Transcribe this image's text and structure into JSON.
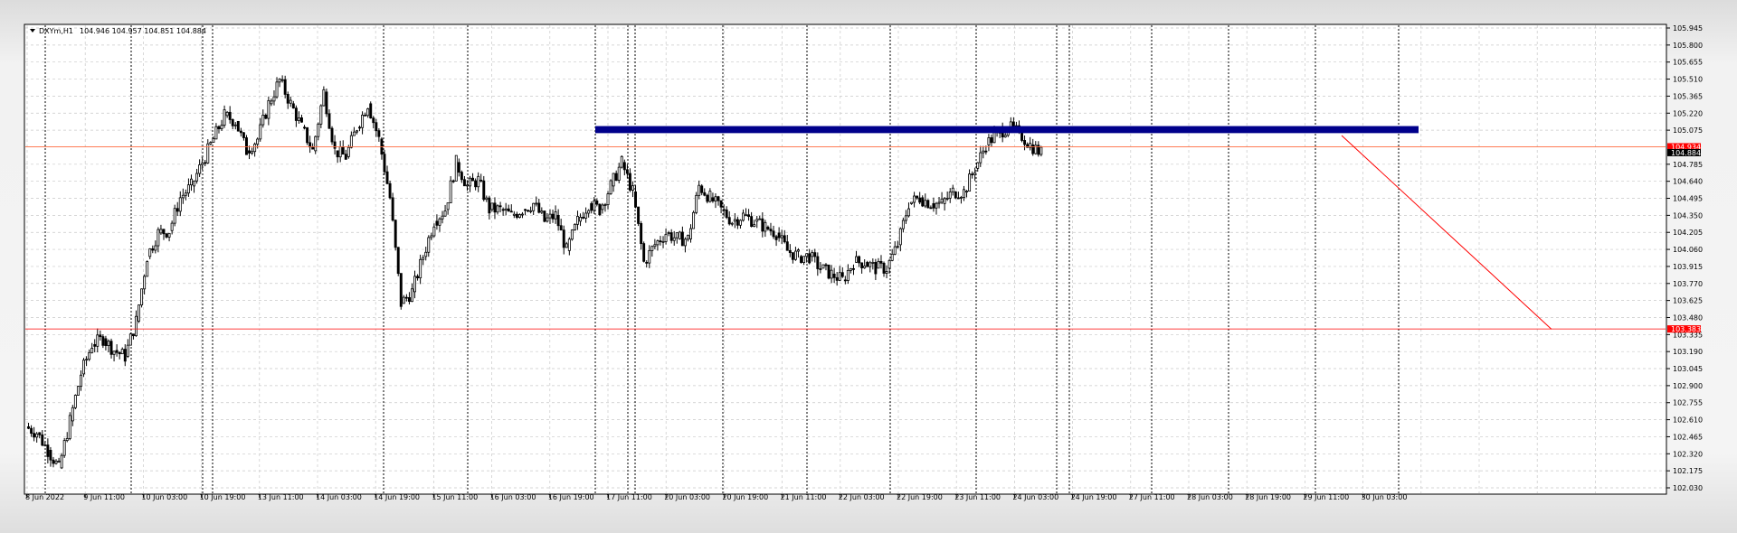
{
  "window": {
    "symbol_label": "DXYm,H1",
    "ohlc_label": "104.946 104.957 104.851 104.884"
  },
  "colors": {
    "background": "#ffffff",
    "grid": "#c8c8c8",
    "candle": "#000000",
    "resistance_zone": "#00008b",
    "support_line": "#ff0000",
    "trend_line": "#ff0000",
    "current_price_tag": "#000000",
    "line_price_tag": "#ff0000"
  },
  "price_scale_labels": [
    "105.945",
    "105.800",
    "105.655",
    "105.510",
    "105.365",
    "105.220",
    "105.075",
    "104.785",
    "104.640",
    "104.495",
    "104.350",
    "104.205",
    "104.060",
    "103.915",
    "103.770",
    "103.625",
    "103.480",
    "103.335",
    "103.190",
    "103.045",
    "102.900",
    "102.755",
    "102.610",
    "102.465",
    "102.320",
    "102.175",
    "102.030"
  ],
  "price_tags": {
    "line_price": "104.934",
    "current_price": "104.884",
    "support_price": "103.383"
  },
  "time_labels": [
    "8 Jun 2022",
    "9 Jun 11:00",
    "10 Jun 03:00",
    "10 Jun 19:00",
    "13 Jun 11:00",
    "14 Jun 03:00",
    "14 Jun 19:00",
    "15 Jun 11:00",
    "16 Jun 03:00",
    "16 Jun 19:00",
    "17 Jun 11:00",
    "20 Jun 03:00",
    "20 Jun 19:00",
    "21 Jun 11:00",
    "22 Jun 03:00",
    "22 Jun 19:00",
    "23 Jun 11:00",
    "24 Jun 03:00",
    "24 Jun 19:00",
    "27 Jun 11:00",
    "28 Jun 03:00",
    "28 Jun 19:00",
    "29 Jun 11:00",
    "30 Jun 03:00"
  ],
  "chart_data": {
    "type": "candlestick",
    "symbol": "DXYm",
    "timeframe": "H1",
    "y_range": [
      102.03,
      105.945
    ],
    "x_range": [
      "8 Jun 2022",
      "30 Jun 03:00"
    ],
    "grid": true,
    "ohlc_last": {
      "open": 104.946,
      "high": 104.957,
      "low": 104.851,
      "close": 104.884
    },
    "horizontal_levels": [
      {
        "kind": "resistance_zone",
        "price_low": 105.05,
        "price_high": 105.11,
        "from": "17 Jun 08:00",
        "to": "1 Jul 00:00"
      },
      {
        "kind": "line",
        "price": 104.934
      },
      {
        "kind": "support_line",
        "price": 103.383
      }
    ],
    "trend_line": {
      "from": {
        "time": "30 Jun 03:00",
        "price": 105.03
      },
      "to": {
        "time": "4 Jul",
        "price": 103.38
      }
    },
    "price_path": [
      {
        "time": "8 Jun 2022",
        "price": 102.55
      },
      {
        "time": "8 Jun 22:00",
        "price": 102.5
      },
      {
        "time": "9 Jun 04:00",
        "price": 102.35
      },
      {
        "time": "9 Jun 07:00",
        "price": 102.2
      },
      {
        "time": "9 Jun 11:00",
        "price": 102.6
      },
      {
        "time": "9 Jun 15:00",
        "price": 103.0
      },
      {
        "time": "9 Jun 19:00",
        "price": 103.25
      },
      {
        "time": "9 Jun 23:00",
        "price": 103.3
      },
      {
        "time": "10 Jun 03:00",
        "price": 103.2
      },
      {
        "time": "10 Jun 07:00",
        "price": 103.15
      },
      {
        "time": "10 Jun 11:00",
        "price": 103.45
      },
      {
        "time": "10 Jun 15:00",
        "price": 104.0
      },
      {
        "time": "10 Jun 19:00",
        "price": 104.2
      },
      {
        "time": "10 Jun 23:00",
        "price": 104.22
      },
      {
        "time": "13 Jun 03:00",
        "price": 104.5
      },
      {
        "time": "13 Jun 07:00",
        "price": 104.6
      },
      {
        "time": "13 Jun 11:00",
        "price": 104.8
      },
      {
        "time": "13 Jun 15:00",
        "price": 105.0
      },
      {
        "time": "13 Jun 19:00",
        "price": 105.2
      },
      {
        "time": "13 Jun 23:00",
        "price": 105.15
      },
      {
        "time": "14 Jun 03:00",
        "price": 104.9
      },
      {
        "time": "14 Jun 07:00",
        "price": 105.0
      },
      {
        "time": "14 Jun 11:00",
        "price": 105.3
      },
      {
        "time": "14 Jun 15:00",
        "price": 105.5
      },
      {
        "time": "14 Jun 19:00",
        "price": 105.3
      },
      {
        "time": "14 Jun 23:00",
        "price": 105.1
      },
      {
        "time": "15 Jun 03:00",
        "price": 104.9
      },
      {
        "time": "15 Jun 07:00",
        "price": 105.4
      },
      {
        "time": "15 Jun 11:00",
        "price": 104.9
      },
      {
        "time": "15 Jun 15:00",
        "price": 104.85
      },
      {
        "time": "15 Jun 19:00",
        "price": 105.1
      },
      {
        "time": "15 Jun 23:00",
        "price": 105.3
      },
      {
        "time": "16 Jun 03:00",
        "price": 105.0
      },
      {
        "time": "16 Jun 07:00",
        "price": 104.5
      },
      {
        "time": "16 Jun 11:00",
        "price": 103.6
      },
      {
        "time": "16 Jun 15:00",
        "price": 103.7
      },
      {
        "time": "16 Jun 19:00",
        "price": 104.0
      },
      {
        "time": "16 Jun 23:00",
        "price": 104.3
      },
      {
        "time": "17 Jun 03:00",
        "price": 104.4
      },
      {
        "time": "17 Jun 07:00",
        "price": 104.8
      },
      {
        "time": "17 Jun 11:00",
        "price": 104.6
      },
      {
        "time": "17 Jun 15:00",
        "price": 104.65
      },
      {
        "time": "17 Jun 19:00",
        "price": 104.4
      },
      {
        "time": "17 Jun 23:00",
        "price": 104.4
      },
      {
        "time": "20 Jun 03:00",
        "price": 104.35
      },
      {
        "time": "20 Jun 07:00",
        "price": 104.4
      },
      {
        "time": "20 Jun 11:00",
        "price": 104.45
      },
      {
        "time": "20 Jun 15:00",
        "price": 104.3
      },
      {
        "time": "20 Jun 19:00",
        "price": 104.35
      },
      {
        "time": "20 Jun 23:00",
        "price": 104.05
      },
      {
        "time": "21 Jun 03:00",
        "price": 104.3
      },
      {
        "time": "21 Jun 07:00",
        "price": 104.45
      },
      {
        "time": "21 Jun 11:00",
        "price": 104.4
      },
      {
        "time": "21 Jun 15:00",
        "price": 104.6
      },
      {
        "time": "21 Jun 19:00",
        "price": 104.8
      },
      {
        "time": "21 Jun 23:00",
        "price": 104.55
      },
      {
        "time": "22 Jun 03:00",
        "price": 103.95
      },
      {
        "time": "22 Jun 07:00",
        "price": 104.1
      },
      {
        "time": "22 Jun 11:00",
        "price": 104.2
      },
      {
        "time": "22 Jun 15:00",
        "price": 104.15
      },
      {
        "time": "22 Jun 19:00",
        "price": 104.15
      },
      {
        "time": "22 Jun 23:00",
        "price": 104.6
      },
      {
        "time": "23 Jun 03:00",
        "price": 104.5
      },
      {
        "time": "23 Jun 07:00",
        "price": 104.4
      },
      {
        "time": "23 Jun 11:00",
        "price": 104.3
      },
      {
        "time": "23 Jun 15:00",
        "price": 104.35
      },
      {
        "time": "23 Jun 19:00",
        "price": 104.3
      },
      {
        "time": "23 Jun 23:00",
        "price": 104.25
      },
      {
        "time": "24 Jun 03:00",
        "price": 104.2
      },
      {
        "time": "24 Jun 07:00",
        "price": 104.05
      },
      {
        "time": "24 Jun 11:00",
        "price": 104.0
      },
      {
        "time": "24 Jun 15:00",
        "price": 104.0
      },
      {
        "time": "24 Jun 19:00",
        "price": 103.9
      },
      {
        "time": "24 Jun 23:00",
        "price": 103.85
      },
      {
        "time": "27 Jun 03:00",
        "price": 103.8
      },
      {
        "time": "27 Jun 07:00",
        "price": 103.95
      },
      {
        "time": "27 Jun 11:00",
        "price": 103.95
      },
      {
        "time": "27 Jun 15:00",
        "price": 103.9
      },
      {
        "time": "27 Jun 19:00",
        "price": 103.9
      },
      {
        "time": "27 Jun 23:00",
        "price": 104.1
      },
      {
        "time": "28 Jun 03:00",
        "price": 104.45
      },
      {
        "time": "28 Jun 07:00",
        "price": 104.5
      },
      {
        "time": "28 Jun 11:00",
        "price": 104.45
      },
      {
        "time": "28 Jun 15:00",
        "price": 104.45
      },
      {
        "time": "28 Jun 19:00",
        "price": 104.55
      },
      {
        "time": "28 Jun 23:00",
        "price": 104.55
      },
      {
        "time": "29 Jun 03:00",
        "price": 104.75
      },
      {
        "time": "29 Jun 07:00",
        "price": 104.95
      },
      {
        "time": "29 Jun 11:00",
        "price": 105.05
      },
      {
        "time": "29 Jun 15:00",
        "price": 105.1
      },
      {
        "time": "29 Jun 19:00",
        "price": 105.05
      },
      {
        "time": "29 Jun 23:00",
        "price": 104.95
      },
      {
        "time": "30 Jun 03:00",
        "price": 104.88
      }
    ]
  }
}
